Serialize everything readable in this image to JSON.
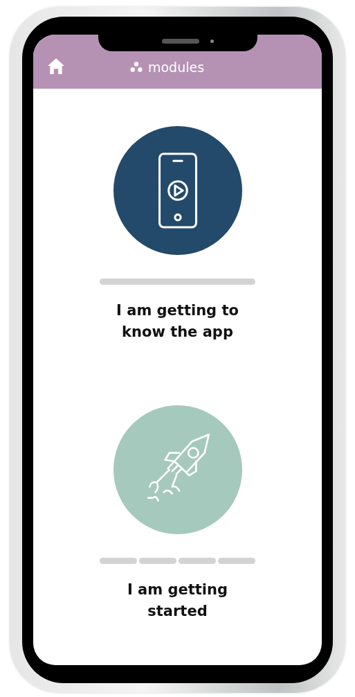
{
  "header": {
    "title": "modules"
  },
  "modules": [
    {
      "kind": "phone",
      "title": "I am getting to know the app",
      "progress": [
        {
          "completed": false
        }
      ]
    },
    {
      "kind": "rocket",
      "title": "I am getting started",
      "progress": [
        {
          "completed": false
        },
        {
          "completed": false
        },
        {
          "completed": false
        },
        {
          "completed": false
        }
      ]
    }
  ]
}
